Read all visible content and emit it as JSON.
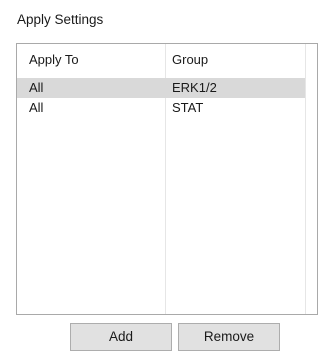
{
  "panel": {
    "title": "Apply Settings"
  },
  "table": {
    "columns": [
      "Apply To",
      "Group"
    ],
    "rows": [
      {
        "apply_to": "All",
        "group": "ERK1/2",
        "selected": true
      },
      {
        "apply_to": "All",
        "group": "STAT",
        "selected": false
      }
    ],
    "selection_color": "#d9d9d9"
  },
  "buttons": {
    "add_label": "Add",
    "remove_label": "Remove"
  }
}
